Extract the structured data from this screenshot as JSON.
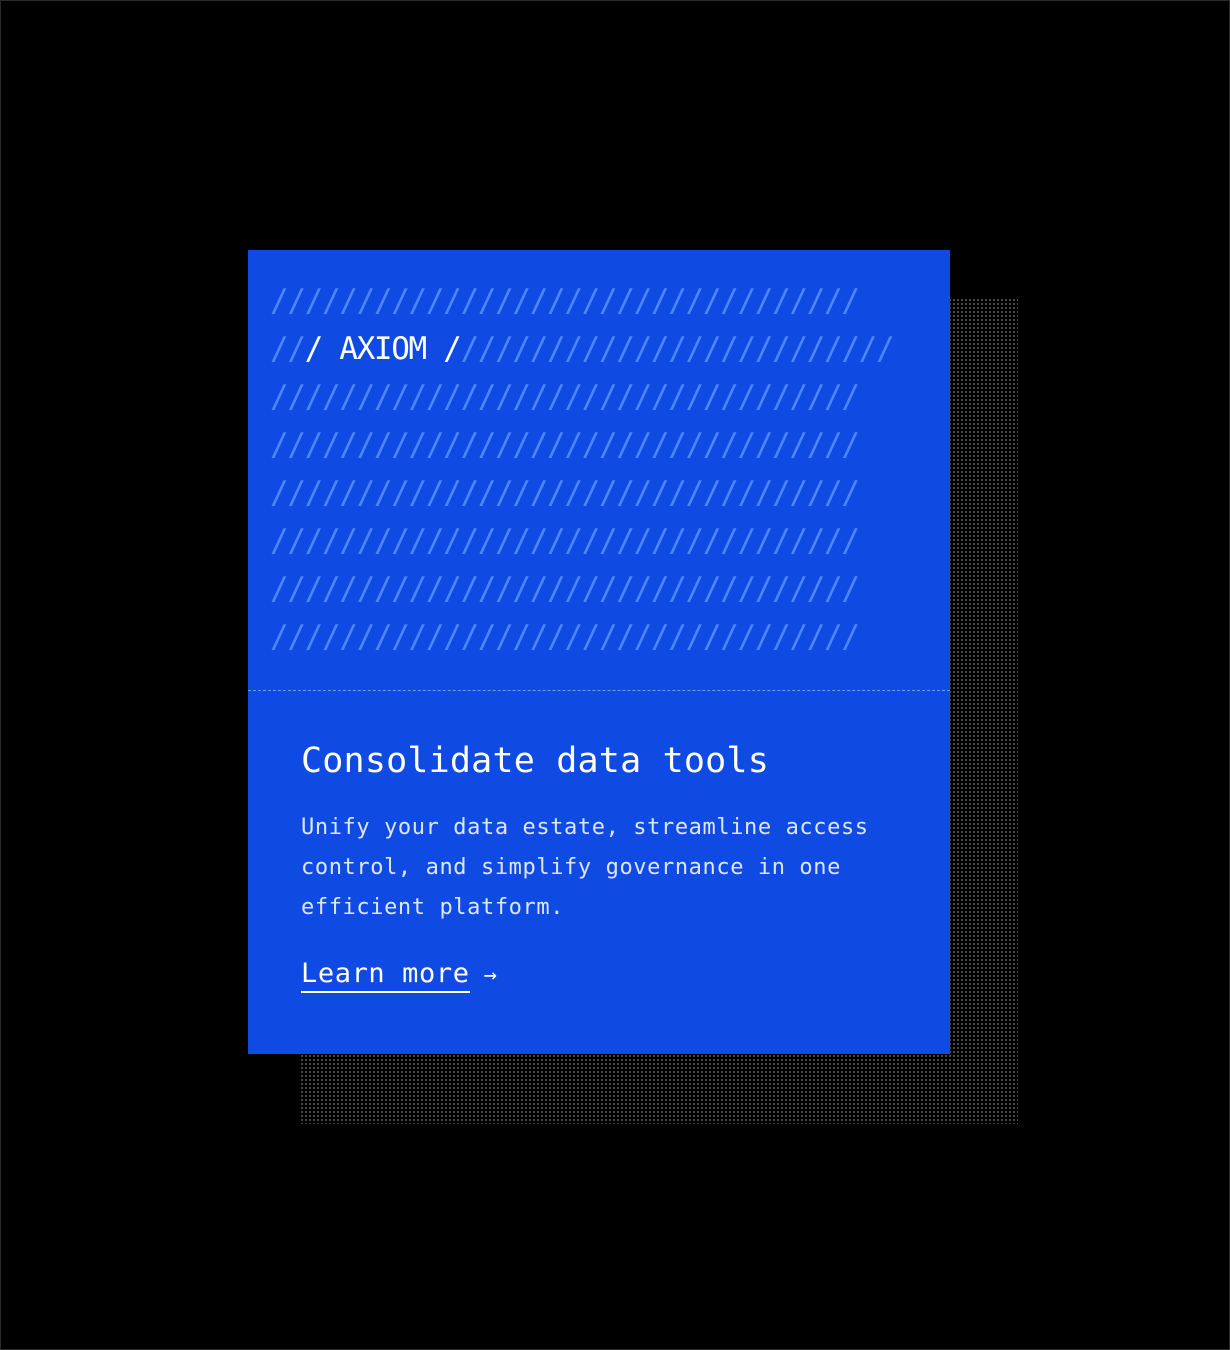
{
  "pattern": {
    "rows": [
      "//////////////////////////////////",
      "//",
      "//////////////////////////////////",
      "//////////////////////////////////",
      "//////////////////////////////////",
      "//////////////////////////////////",
      "//////////////////////////////////",
      "//////////////////////////////////"
    ],
    "brand_label": "/ AXIOM /",
    "row2_tail": "/////////////////////////"
  },
  "card": {
    "title": "Consolidate data tools",
    "description": "Unify your data estate, streamline access control, and simplify governance in one efficient platform.",
    "link_label": "Learn more",
    "link_icon": "→",
    "accent_color": "#0f4ae3"
  }
}
